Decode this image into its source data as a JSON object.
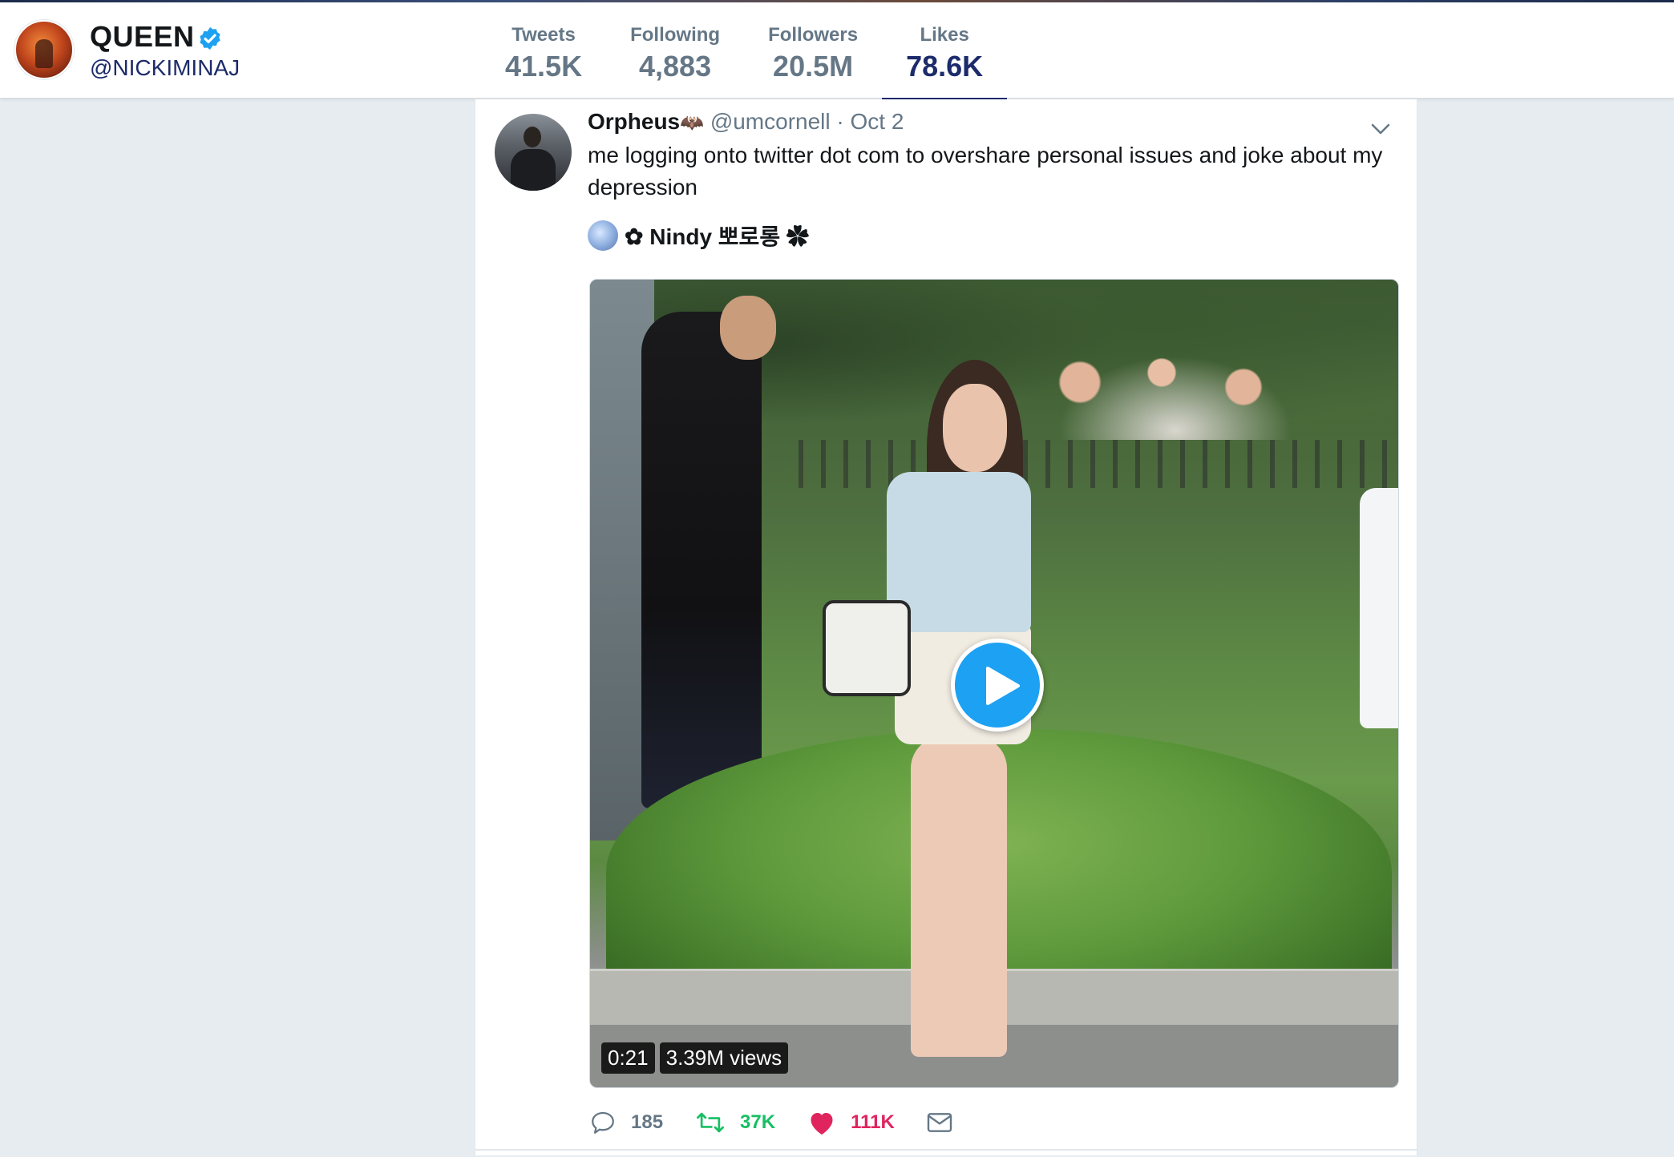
{
  "profile": {
    "name": "QUEEN",
    "handle": "@NICKIMINAJ",
    "verified": true
  },
  "stats": [
    {
      "label": "Tweets",
      "value": "41.5K",
      "active": false
    },
    {
      "label": "Following",
      "value": "4,883",
      "active": false
    },
    {
      "label": "Followers",
      "value": "20.5M",
      "active": false
    },
    {
      "label": "Likes",
      "value": "78.6K",
      "active": true
    }
  ],
  "tweet": {
    "author_name": "Orpheus",
    "author_badge": "🦇",
    "author_handle": "@umcornell",
    "separator": "·",
    "date": "Oct 2",
    "text": "me logging onto twitter dot com to overshare personal issues and joke about my depression",
    "quoted_account": "✿ Nindy 뽀로롱 ✿",
    "video": {
      "duration": "0:21",
      "views": "3.39M views"
    },
    "actions": {
      "replies": "185",
      "retweets": "37K",
      "likes": "111K"
    }
  },
  "colors": {
    "accent": "#1da1f2",
    "active_tab": "#1c2b6b",
    "retweet": "#17bf63",
    "like": "#e0245e",
    "background": "#e6ecf0"
  },
  "icons": [
    "verified-badge-icon",
    "chevron-down-icon",
    "play-icon",
    "reply-icon",
    "retweet-icon",
    "heart-icon",
    "envelope-icon"
  ]
}
